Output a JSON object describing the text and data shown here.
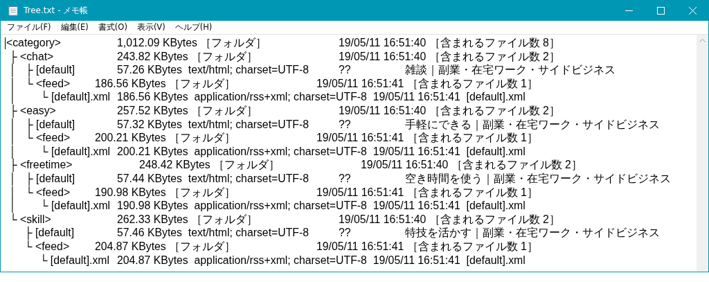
{
  "window": {
    "title": "Tree.txt - メモ帳"
  },
  "menu": [
    "ファイル(F)",
    "編集(E)",
    "書式(O)",
    "表示(V)",
    "ヘルプ(H)"
  ],
  "lines": [
    "<category>\t\t\t1,012.09 KBytes ［フォルダ］\t\t\t\t19/05/11 16:51:40 ［含まれるファイル数 8］",
    " ├ <chat>\t\t\t243.82 KBytes ［フォルダ］\t\t\t\t19/05/11 16:51:40 ［含まれるファイル数 2］",
    " │   ├ [default]\t\t57.26 KBytes  text/html; charset=UTF-8\t\t??\t\t\t雑談｜副業・在宅ワーク・サイドビジネス",
    " │   └ <feed>\t\t186.56 KBytes ［フォルダ］\t\t\t\t19/05/11 16:51:41 ［含まれるファイル数 1］",
    " │        └ [default].xml\t186.56 KBytes  application/rss+xml; charset=UTF-8  19/05/11 16:51:41  [default].xml",
    " ├ <easy>\t\t\t257.52 KBytes ［フォルダ］\t\t\t\t19/05/11 16:51:40 ［含まれるファイル数 2］",
    " │   ├ [default]\t\t57.32 KBytes  text/html; charset=UTF-8\t\t??\t\t\t手軽にできる｜副業・在宅ワーク・サイドビジネス",
    " │   └ <feed>\t\t200.21 KBytes ［フォルダ］\t\t\t\t19/05/11 16:51:41 ［含まれるファイル数 1］",
    " │        └ [default].xml\t200.21 KBytes  application/rss+xml; charset=UTF-8  19/05/11 16:51:41  [default].xml",
    " ├ <freetime>\t\t\t248.42 KBytes ［フォルダ］\t\t\t\t19/05/11 16:51:40 ［含まれるファイル数 2］",
    " │   ├ [default]\t\t57.44 KBytes  text/html; charset=UTF-8\t\t??\t\t\t空き時間を使う｜副業・在宅ワーク・サイドビジネス",
    " │   └ <feed>\t\t190.98 KBytes ［フォルダ］\t\t\t\t19/05/11 16:51:41 ［含まれるファイル数 1］",
    " │        └ [default].xml\t190.98 KBytes  application/rss+xml; charset=UTF-8  19/05/11 16:51:41  [default].xml",
    " └ <skill>\t\t\t262.33 KBytes ［フォルダ］\t\t\t\t19/05/11 16:51:40 ［含まれるファイル数 2］",
    "      ├ [default]\t\t57.46 KBytes  text/html; charset=UTF-8\t\t??\t\t\t特技を活かす｜副業・在宅ワーク・サイドビジネス",
    "      └ <feed>\t\t204.87 KBytes ［フォルダ］\t\t\t\t19/05/11 16:51:41 ［含まれるファイル数 1］",
    "           └ [default].xml\t204.87 KBytes  application/rss+xml; charset=UTF-8  19/05/11 16:51:41  [default].xml"
  ]
}
